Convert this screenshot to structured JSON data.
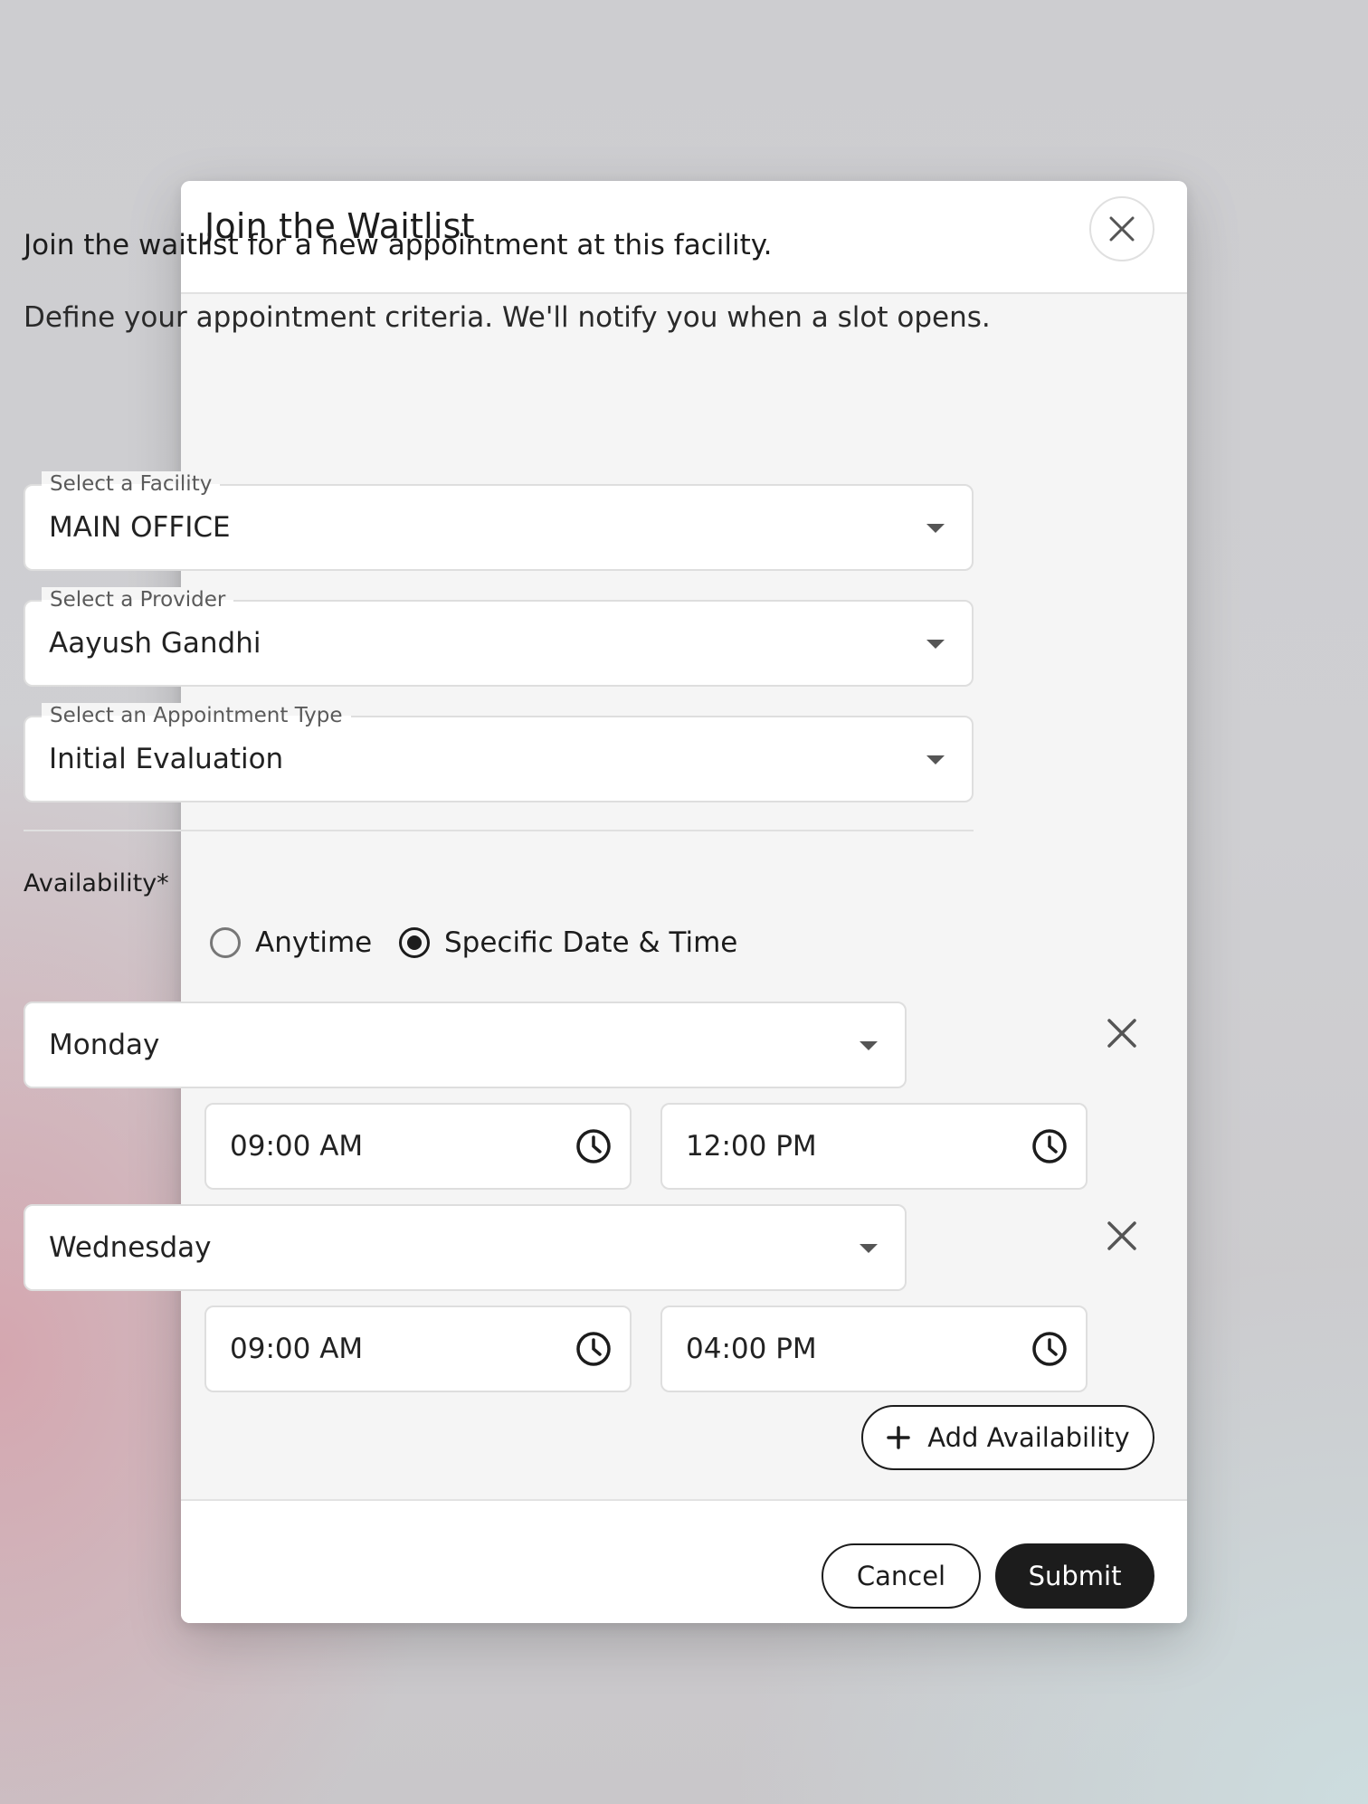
{
  "modal": {
    "title": "Join the Waitlist",
    "close_icon": "close-icon"
  },
  "intro": {
    "line1": "Join the waitlist for a new appointment at this facility.",
    "line2": "Define your appointment criteria. We'll notify you when a slot opens."
  },
  "facility": {
    "label": "Select a Facility",
    "value": "MAIN OFFICE"
  },
  "provider": {
    "label": "Select a Provider",
    "value": "Aayush Gandhi"
  },
  "appointment_type": {
    "label": "Select an Appointment Type",
    "value": "Initial Evaluation"
  },
  "availability": {
    "label": "Availability*",
    "options": [
      {
        "label": "Anytime",
        "selected": false
      },
      {
        "label": "Specific Date & Time",
        "selected": true
      }
    ],
    "slots": [
      {
        "day": "Monday",
        "start": "09:00 AM",
        "end": "12:00 PM"
      },
      {
        "day": "Wednesday",
        "start": "09:00 AM",
        "end": "04:00 PM"
      }
    ],
    "add_label": "Add Availability"
  },
  "footer": {
    "cancel_label": "Cancel",
    "submit_label": "Submit"
  },
  "colors": {
    "primary": "#1c1c1c",
    "body_background": "#f5f5f5",
    "border": "#dedede"
  }
}
